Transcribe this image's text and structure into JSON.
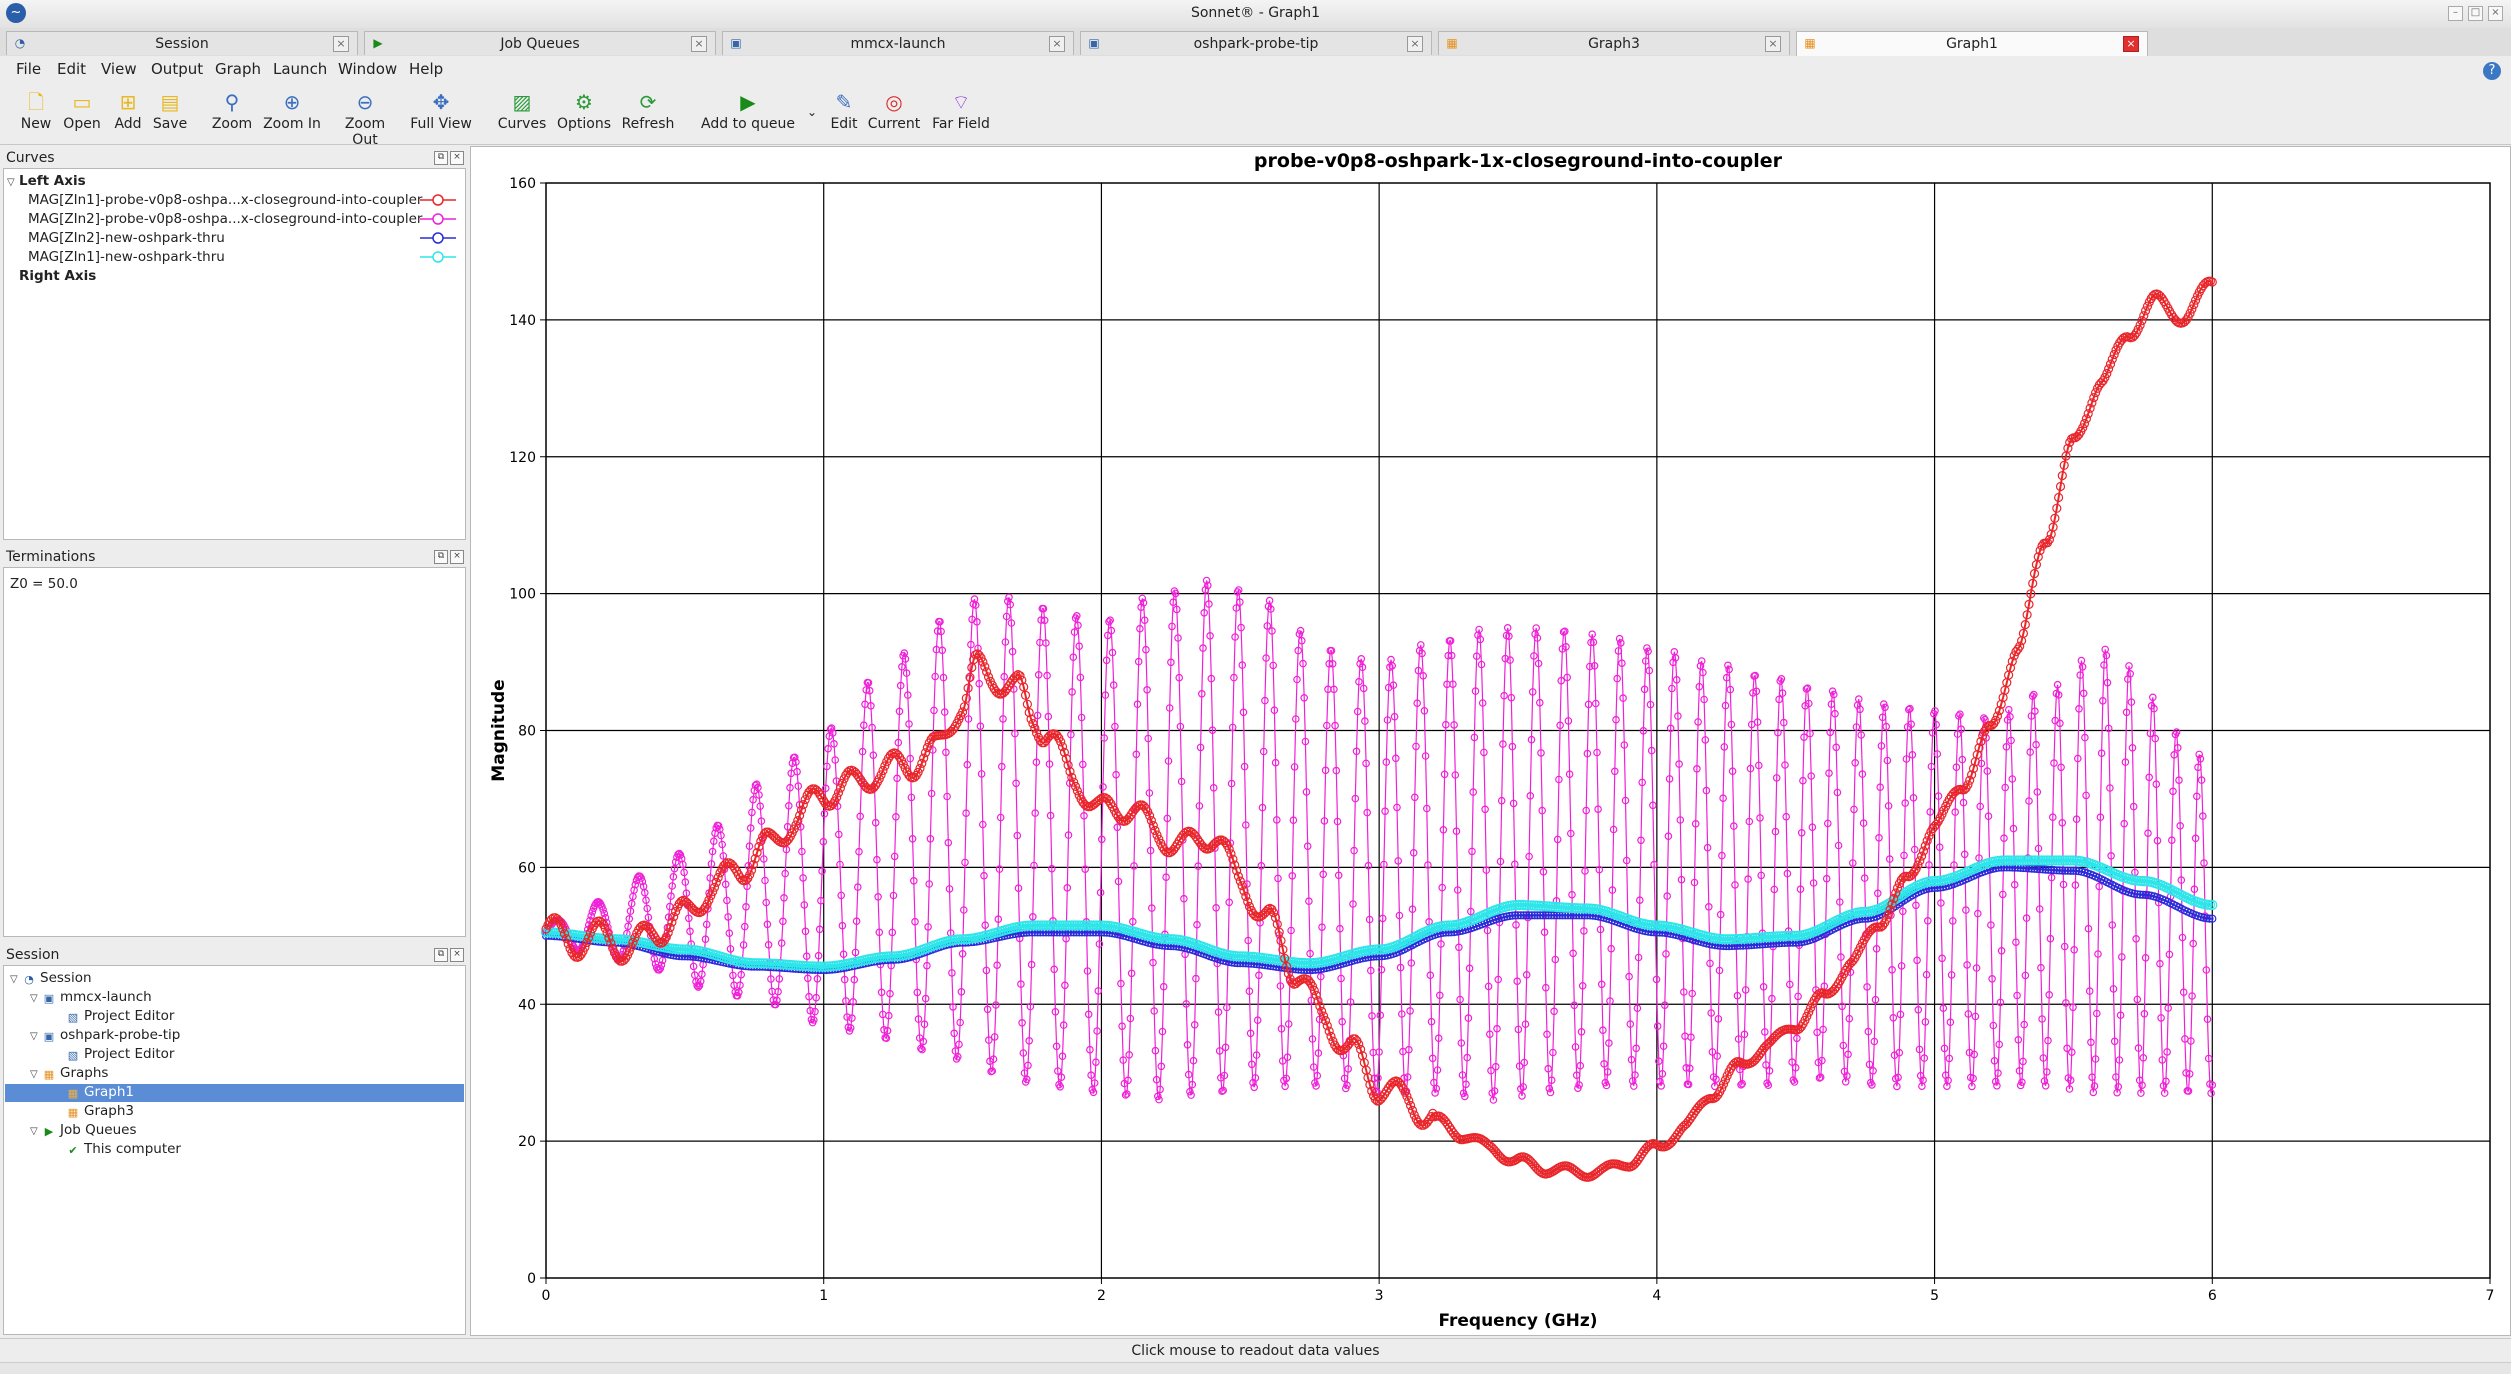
{
  "window": {
    "title": "Sonnet® - Graph1"
  },
  "tabs": [
    {
      "label": "Session",
      "icon": "sonnet-session-icon",
      "active": false
    },
    {
      "label": "Job Queues",
      "icon": "job-queue-icon",
      "active": false
    },
    {
      "label": "mmcx-launch",
      "icon": "project-icon",
      "active": false
    },
    {
      "label": "oshpark-probe-tip",
      "icon": "project-icon",
      "active": false
    },
    {
      "label": "Graph3",
      "icon": "graph-icon",
      "active": false
    },
    {
      "label": "Graph1",
      "icon": "graph-icon",
      "active": true
    }
  ],
  "menu": [
    "File",
    "Edit",
    "View",
    "Output",
    "Graph",
    "Launch",
    "Window",
    "Help"
  ],
  "toolbar": [
    {
      "label": "New",
      "icon": "new-file-icon"
    },
    {
      "label": "Open",
      "icon": "open-folder-icon"
    },
    {
      "label": "Add",
      "icon": "add-folder-icon"
    },
    {
      "label": "Save",
      "icon": "save-icon"
    },
    {
      "label": "Zoom",
      "icon": "zoom-icon"
    },
    {
      "label": "Zoom In",
      "icon": "zoom-in-icon"
    },
    {
      "label": "Zoom Out",
      "icon": "zoom-out-icon"
    },
    {
      "label": "Full View",
      "icon": "full-view-icon"
    },
    {
      "label": "Curves",
      "icon": "curves-icon"
    },
    {
      "label": "Options",
      "icon": "options-icon"
    },
    {
      "label": "Refresh",
      "icon": "refresh-icon"
    },
    {
      "label": "Add to queue",
      "icon": "add-to-queue-icon"
    },
    {
      "label": "Edit",
      "icon": "edit-icon"
    },
    {
      "label": "Current",
      "icon": "current-icon"
    },
    {
      "label": "Far Field",
      "icon": "far-field-icon"
    }
  ],
  "curves_panel": {
    "title": "Curves",
    "left_axis_label": "Left Axis",
    "right_axis_label": "Right Axis",
    "items": [
      {
        "label": "MAG[ZIn1]-probe-v0p8-oshpa...x-closeground-into-coupler",
        "color": "#e8262b"
      },
      {
        "label": "MAG[ZIn2]-probe-v0p8-oshpa...x-closeground-into-coupler",
        "color": "#f020d8"
      },
      {
        "label": "MAG[ZIn2]-new-oshpark-thru",
        "color": "#2b2bd8"
      },
      {
        "label": "MAG[ZIn1]-new-oshpark-thru",
        "color": "#2ee6ea"
      }
    ]
  },
  "terminations_panel": {
    "title": "Terminations",
    "text": "Z0 = 50.0"
  },
  "session_panel": {
    "title": "Session",
    "tree": [
      {
        "label": "Session",
        "icon": "sonnet-session-icon",
        "expanded": true
      },
      {
        "label": "mmcx-launch",
        "icon": "project-icon",
        "expanded": true
      },
      {
        "label": "Project Editor",
        "icon": "project-editor-icon"
      },
      {
        "label": "oshpark-probe-tip",
        "icon": "project-icon",
        "expanded": true
      },
      {
        "label": "Project Editor",
        "icon": "project-editor-icon"
      },
      {
        "label": "Graphs",
        "icon": "graphs-folder-icon",
        "expanded": true
      },
      {
        "label": "Graph1",
        "icon": "graph-icon",
        "selected": true
      },
      {
        "label": "Graph3",
        "icon": "graph-icon"
      },
      {
        "label": "Job Queues",
        "icon": "job-queue-icon",
        "expanded": true
      },
      {
        "label": "This computer",
        "icon": "checkmark-icon"
      }
    ]
  },
  "status": {
    "text": "Click mouse to readout data values"
  },
  "colors": {
    "selection": "#5b8dd6",
    "active_tab_close": "#e03030"
  },
  "chart_data": {
    "type": "line",
    "title": "probe-v0p8-oshpark-1x-closeground-into-coupler",
    "xlabel": "Frequency (GHz)",
    "ylabel": "Magnitude",
    "xlim": [
      0,
      7
    ],
    "ylim": [
      0,
      160
    ],
    "xticks": [
      "0",
      "1",
      "2",
      "3",
      "4",
      "5",
      "6",
      "7"
    ],
    "yticks": [
      "0",
      "20",
      "40",
      "60",
      "80",
      "100",
      "120",
      "140",
      "160"
    ],
    "grid": true,
    "marker": "circle",
    "series": [
      {
        "name": "MAG[ZIn1]-probe-v0p8-oshpa...x-closeground-into-coupler",
        "color": "#e8262b",
        "x": [
          0,
          0.1,
          0.2,
          0.3,
          0.4,
          0.5,
          0.6,
          0.7,
          0.8,
          0.9,
          1.0,
          1.1,
          1.2,
          1.3,
          1.4,
          1.5,
          1.55,
          1.6,
          1.7,
          1.75,
          1.8,
          1.9,
          2.0,
          2.1,
          2.2,
          2.3,
          2.4,
          2.5,
          2.6,
          2.7,
          2.8,
          2.9,
          3.0,
          3.1,
          3.2,
          3.3,
          3.4,
          3.5,
          3.6,
          3.7,
          3.8,
          3.9,
          4.0,
          4.1,
          4.2,
          4.3,
          4.4,
          4.5,
          4.6,
          4.7,
          4.8,
          4.9,
          5.0,
          5.1,
          5.2,
          5.3,
          5.4,
          5.5,
          5.6,
          5.7,
          5.8,
          5.9,
          6.0
        ],
        "y": [
          51,
          49,
          50,
          48,
          51,
          53,
          57,
          60,
          63,
          67,
          71,
          72,
          74,
          75,
          77,
          84,
          89,
          88,
          86,
          82,
          80,
          73,
          68,
          69,
          65,
          63,
          65,
          58,
          52,
          45,
          38,
          33,
          28,
          26,
          23,
          21,
          19,
          17,
          16,
          15.5,
          15.5,
          17,
          19,
          22,
          27,
          31,
          34,
          37,
          41,
          46,
          52,
          58,
          66,
          72,
          80,
          92,
          108,
          122,
          131,
          138,
          143,
          140,
          146
        ]
      },
      {
        "name": "MAG[ZIn2]-probe-v0p8-oshpa...x-closeground-into-coupler",
        "color": "#f020d8",
        "note_envelope_upper": [
          52,
          55,
          60,
          66,
          73,
          80,
          88,
          96,
          100,
          98,
          96,
          100,
          102,
          99,
          92,
          90,
          93,
          95,
          95,
          94,
          92,
          90,
          88,
          86,
          84,
          83,
          82,
          86,
          92,
          76
        ],
        "note_envelope_lower": [
          49,
          47,
          45,
          42,
          40,
          37,
          35,
          33,
          30,
          28,
          27,
          26,
          27,
          28,
          28,
          27,
          27,
          26,
          27,
          28,
          28,
          28,
          28,
          29,
          28,
          28,
          28,
          28,
          27,
          27
        ],
        "x": [
          0,
          0.2,
          0.4,
          0.6,
          0.8,
          1.0,
          1.2,
          1.4,
          1.6,
          1.8,
          2.0,
          2.2,
          2.4,
          2.6,
          2.8,
          3.0,
          3.2,
          3.4,
          3.6,
          3.8,
          4.0,
          4.2,
          4.4,
          4.6,
          4.8,
          5.0,
          5.2,
          5.4,
          5.6,
          6.0
        ],
        "y": [
          50,
          51,
          52,
          54,
          56,
          55,
          57,
          58,
          62,
          60,
          59,
          60,
          62,
          63,
          62,
          59,
          60,
          61,
          61,
          61,
          60,
          59,
          58,
          57,
          56,
          55,
          55,
          57,
          59,
          52
        ]
      },
      {
        "name": "MAG[ZIn2]-new-oshpark-thru",
        "color": "#2b2bd8",
        "x": [
          0,
          0.25,
          0.5,
          0.75,
          1.0,
          1.25,
          1.5,
          1.75,
          2.0,
          2.25,
          2.5,
          2.75,
          3.0,
          3.25,
          3.5,
          3.75,
          4.0,
          4.25,
          4.5,
          4.75,
          5.0,
          5.25,
          5.5,
          5.75,
          6.0
        ],
        "y": [
          50,
          49,
          47,
          45.5,
          45,
          46.5,
          49,
          50.5,
          50.5,
          48.5,
          46,
          45,
          47,
          50.5,
          53,
          53,
          50.5,
          48.5,
          49,
          52.5,
          57,
          60,
          59.5,
          56,
          52.5
        ]
      },
      {
        "name": "MAG[ZIn1]-new-oshpark-thru",
        "color": "#2ee6ea",
        "x": [
          0,
          0.25,
          0.5,
          0.75,
          1.0,
          1.25,
          1.5,
          1.75,
          2.0,
          2.25,
          2.5,
          2.75,
          3.0,
          3.25,
          3.5,
          3.75,
          4.0,
          4.25,
          4.5,
          4.75,
          5.0,
          5.25,
          5.5,
          5.75,
          6.0
        ],
        "y": [
          50.5,
          49.5,
          48,
          46,
          45.5,
          47,
          49.5,
          51.5,
          51.5,
          49.5,
          47,
          46,
          48,
          51.5,
          54.5,
          54,
          51.5,
          49.5,
          50,
          53.5,
          58,
          61,
          61,
          58,
          54.5
        ]
      }
    ]
  }
}
